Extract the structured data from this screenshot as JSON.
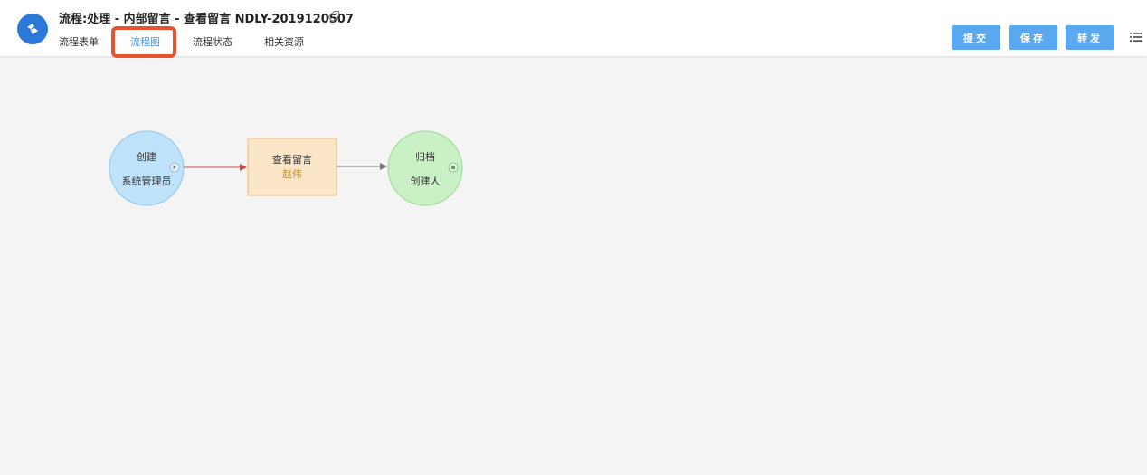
{
  "header": {
    "title": "流程:处理 - 内部留言 - 查看留言 NDLY-2019120507",
    "logo_icon": "app-logo-icon",
    "tag_icon": "tag-icon"
  },
  "tabs": [
    {
      "label": "流程表单",
      "active": false
    },
    {
      "label": "流程图",
      "active": true
    },
    {
      "label": "流程状态",
      "active": false
    },
    {
      "label": "相关资源",
      "active": false
    }
  ],
  "actions": {
    "submit_label": "提交",
    "save_label": "保存",
    "forward_label": "转发",
    "button_color": "#5aa8ef",
    "menu_icon": "list-menu-icon"
  },
  "flow": {
    "start": {
      "title": "创建",
      "assignee": "系统管理员",
      "color": "#bfe3fb"
    },
    "task": {
      "title": "查看留言",
      "assignee": "赵伟",
      "color": "#fbe6c8"
    },
    "end": {
      "title": "归档",
      "assignee": "创建人",
      "color": "#c9f1c5"
    }
  },
  "colors": {
    "accent": "#4a90e2",
    "highlight": "#e8532e",
    "logo": "#2a79d7"
  }
}
